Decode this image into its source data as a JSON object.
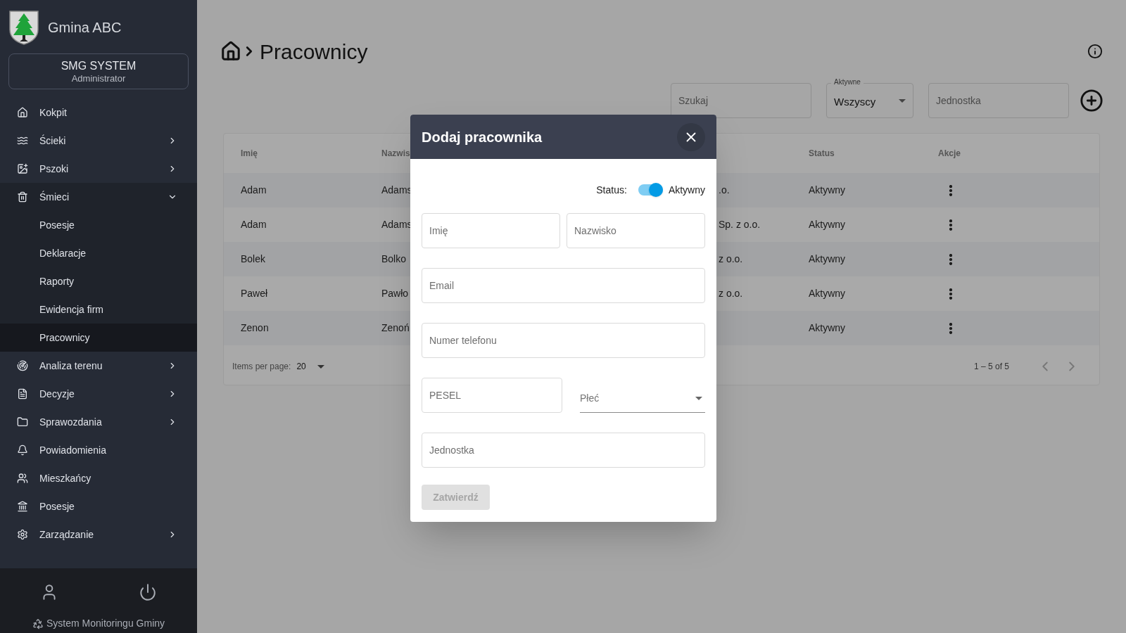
{
  "sidebar": {
    "brand": "Gmina ABC",
    "user": {
      "name": "SMG SYSTEM",
      "role": "Administrator"
    },
    "items": [
      {
        "label": "Kokpit",
        "selected": false
      },
      {
        "label": "Ścieki",
        "expanded": false,
        "selected": false
      },
      {
        "label": "Pszoki",
        "expanded": false,
        "selected": false
      },
      {
        "label": "Śmieci",
        "expanded": true,
        "selected": false,
        "children": [
          {
            "label": "Posesje",
            "selected": false
          },
          {
            "label": "Deklaracje",
            "selected": false
          },
          {
            "label": "Raporty",
            "selected": false
          },
          {
            "label": "Ewidencja firm",
            "selected": false
          },
          {
            "label": "Pracownicy",
            "selected": true
          }
        ]
      },
      {
        "label": "Analiza terenu",
        "expanded": false,
        "selected": false
      },
      {
        "label": "Decyzje",
        "expanded": false,
        "selected": false
      },
      {
        "label": "Sprawozdania",
        "expanded": false,
        "selected": false
      },
      {
        "label": "Powiadomienia",
        "selected": false
      },
      {
        "label": "Mieszkańcy",
        "selected": false
      },
      {
        "label": "Posesje",
        "selected": false
      },
      {
        "label": "Zarządzanie",
        "expanded": false,
        "selected": false
      }
    ],
    "footer": {
      "text": "System Monitoringu Gminy"
    }
  },
  "page": {
    "title": "Pracownicy"
  },
  "filters": {
    "search": {
      "placeholder": "Szukaj"
    },
    "active": {
      "label": "Aktywne",
      "value": "Wszyscy"
    },
    "unit": {
      "placeholder": "Jednostka"
    }
  },
  "table": {
    "columns": [
      "Imię",
      "Nazwis",
      "Status",
      "Akcje"
    ],
    "rows": [
      {
        "column_1": "Adam",
        "column_2": "Adams",
        "column_3": ".o.",
        "status": "Aktywny"
      },
      {
        "column_1": "Adam",
        "column_2": "Adams",
        "column_3": "Sp. z o.o.",
        "status": "Aktywny"
      },
      {
        "column_1": "Bolek",
        "column_2": "Bolko",
        "column_3": "z o.o.",
        "status": "Aktywny"
      },
      {
        "column_1": "Paweł",
        "column_2": "Pawło",
        "column_3": "z o.o.",
        "status": "Aktywny"
      },
      {
        "column_1": "Zenon",
        "column_2": "Zenoń",
        "status": "Aktywny"
      }
    ],
    "paginator": {
      "label": "Items per page:",
      "page_size": "20",
      "range": "1 – 5 of 5"
    }
  },
  "dialog": {
    "title": "Dodaj pracownika",
    "status": {
      "label": "Status:",
      "on": true,
      "text": "Aktywny"
    },
    "rows": [
      [
        {
          "kind": "text",
          "placeholder": "Imię"
        },
        {
          "kind": "text",
          "placeholder": "Nazwisko"
        }
      ],
      [
        {
          "kind": "text",
          "placeholder": "Email"
        }
      ],
      [
        {
          "kind": "text",
          "placeholder": "Numer telefonu"
        }
      ],
      [
        {
          "kind": "text",
          "placeholder": "PESEL"
        },
        {
          "kind": "select",
          "placeholder": "Płeć"
        }
      ],
      [
        {
          "kind": "text",
          "placeholder": "Jednostka"
        }
      ]
    ],
    "submit": {
      "label": "Zatwierdź",
      "disabled": true
    }
  }
}
